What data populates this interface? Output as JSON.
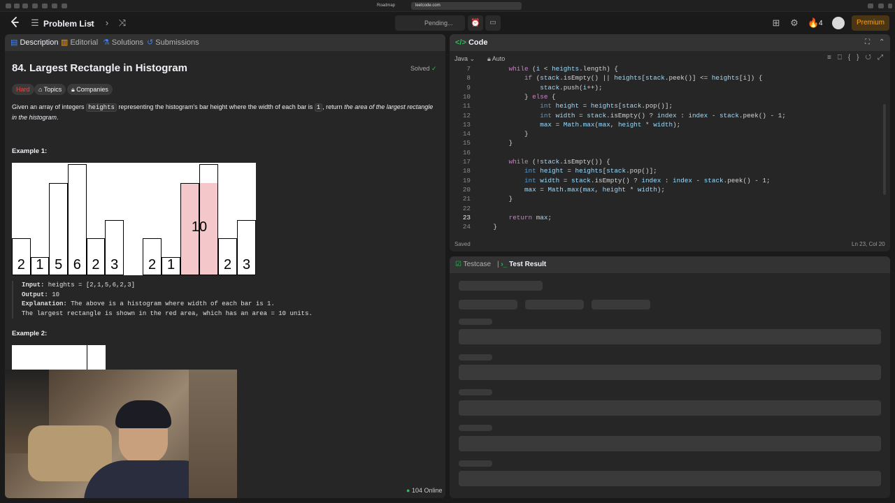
{
  "browser": {
    "tabs": [
      "Roadmap",
      "leetcode.com"
    ]
  },
  "nav": {
    "problem_list": "Problem List",
    "pending": "Pending...",
    "streak": "4",
    "premium": "Premium"
  },
  "left": {
    "tabs": [
      "Description",
      "Editorial",
      "Solutions",
      "Submissions"
    ],
    "title": "84. Largest Rectangle in Histogram",
    "solved": "Solved",
    "difficulty": "Hard",
    "topics": "Topics",
    "companies": "Companies",
    "desc_a": "Given an array of integers ",
    "desc_code1": "heights",
    "desc_b": " representing the histogram's bar height where the width of each bar is ",
    "desc_code2": "1",
    "desc_c": ", return ",
    "desc_italic": "the area of the largest rectangle in the histogram",
    "desc_d": ".",
    "example1": "Example 1:",
    "example2": "Example 2:",
    "input_label": "Input:",
    "input_value": " heights = [2,1,5,6,2,3]",
    "output_label": "Output:",
    "output_value": " 10",
    "explanation_label": "Explanation:",
    "explanation_value": " The above is a histogram where width of each bar is 1.",
    "explanation_line2": "The largest rectangle is shown in the red area, which has an area = 10 units.",
    "online": "104 Online"
  },
  "histogram_left": {
    "max": 6,
    "values": [
      2,
      1,
      5,
      6,
      2,
      3
    ],
    "highlight": []
  },
  "histogram_right": {
    "max": 6,
    "values": [
      2,
      1,
      5,
      6,
      2,
      3
    ],
    "highlight": [
      2,
      3
    ],
    "highlight_label": "10"
  },
  "code_panel": {
    "title": "Code",
    "language": "Java",
    "mode": "Auto",
    "saved": "Saved",
    "cursor": "Ln 23, Col 20",
    "lines": [
      {
        "n": "7",
        "t": "        while (i < heights.length) {"
      },
      {
        "n": "8",
        "t": "            if (stack.isEmpty() || heights[stack.peek()] <= heights[i]) {"
      },
      {
        "n": "9",
        "t": "                stack.push(i++);"
      },
      {
        "n": "10",
        "t": "            } else {"
      },
      {
        "n": "11",
        "t": "                int height = heights[stack.pop()];"
      },
      {
        "n": "12",
        "t": "                int width = stack.isEmpty() ? index : index - stack.peek() - 1;"
      },
      {
        "n": "13",
        "t": "                max = Math.max(max, height * width);"
      },
      {
        "n": "14",
        "t": "            }"
      },
      {
        "n": "15",
        "t": "        }"
      },
      {
        "n": "16",
        "t": ""
      },
      {
        "n": "17",
        "t": "        while (!stack.isEmpty()) {"
      },
      {
        "n": "18",
        "t": "            int height = heights[stack.pop()];"
      },
      {
        "n": "19",
        "t": "            int width = stack.isEmpty() ? index : index - stack.peek() - 1;"
      },
      {
        "n": "20",
        "t": "            max = Math.max(max, height * width);"
      },
      {
        "n": "21",
        "t": "        }"
      },
      {
        "n": "22",
        "t": ""
      },
      {
        "n": "23",
        "t": "        return max;"
      },
      {
        "n": "24",
        "t": "    }"
      }
    ]
  },
  "result_panel": {
    "tabs": [
      "Testcase",
      "Test Result"
    ]
  },
  "colors": {
    "accent": "#ffa116",
    "solved": "#2cbb5d",
    "hard": "#ef4743",
    "highlight_bar": "#f4c7cb",
    "premium_bg": "#4a3515",
    "code_keyword": "#c586c0",
    "code_type": "#569cd6",
    "code_var": "#9cdcfe"
  }
}
